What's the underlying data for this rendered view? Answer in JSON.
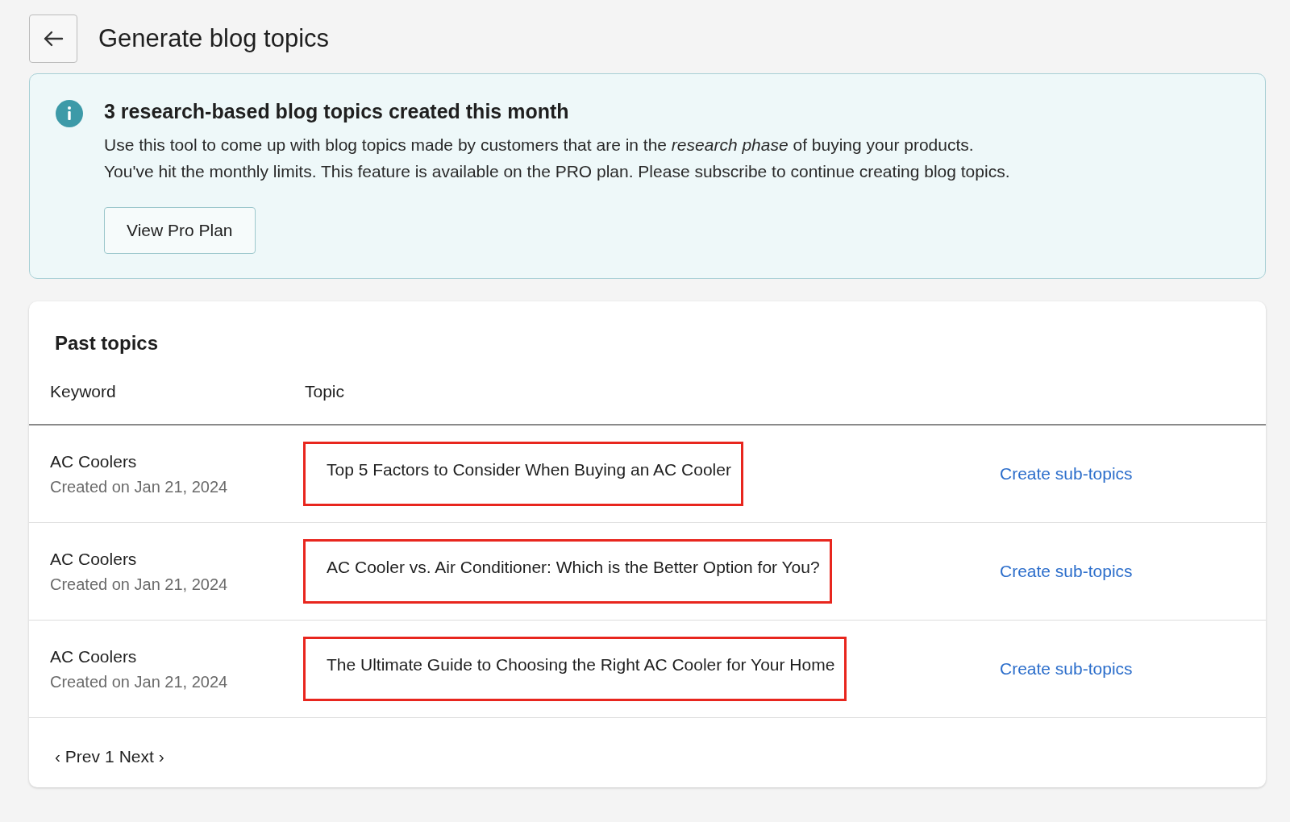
{
  "header": {
    "title": "Generate blog topics"
  },
  "banner": {
    "title": "3 research-based blog topics created this month",
    "lines": [
      "Use this tool to come up with blog topics made by customers that are in the *research phase* of buying your products.",
      "You've hit the monthly limits. This feature is available on the PRO plan. Please subscribe to continue creating blog topics."
    ],
    "button": "View Pro Plan"
  },
  "past_topics": {
    "title": "Past topics",
    "columns": [
      "Keyword",
      "Topic"
    ],
    "rows": [
      {
        "keyword": "AC Coolers",
        "created": "Created on Jan 21, 2024",
        "topic": "Top 5 Factors to Consider When Buying an AC Cooler",
        "highlighted": true,
        "action": "Create sub-topics"
      },
      {
        "keyword": "AC Coolers",
        "created": "Created on Jan 21, 2024",
        "topic": "AC Cooler vs. Air Conditioner: Which is the Better Option for You?",
        "highlighted": true,
        "action": "Create sub-topics"
      },
      {
        "keyword": "AC Coolers",
        "created": "Created on Jan 21, 2024",
        "topic": "The Ultimate Guide to Choosing the Right AC Cooler for Your Home",
        "highlighted": true,
        "action": "Create sub-topics"
      }
    ],
    "pagination": {
      "prev": "‹ Prev",
      "page": "1",
      "next": "Next ›"
    }
  }
}
